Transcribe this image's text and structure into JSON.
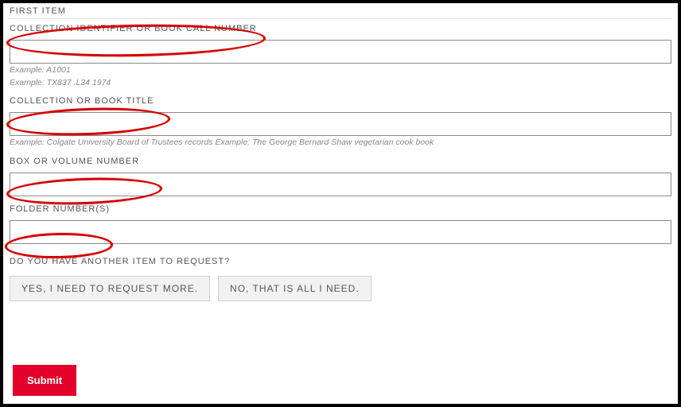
{
  "header": {
    "first_item": "FIRST ITEM"
  },
  "fields": {
    "collection_id": {
      "label": "COLLECTION IDENTIFIER OR BOOK CALL NUMBER",
      "help1": "Example: A1001",
      "help2": "Example: TX837 .L34 1974"
    },
    "collection_title": {
      "label": "COLLECTION OR BOOK TITLE",
      "help": "Example: Colgate University Board of Trustees records Example: The George Bernard Shaw vegetarian cook book"
    },
    "box_volume": {
      "label": "BOX OR VOLUME NUMBER"
    },
    "folder": {
      "label": "FOLDER NUMBER(S)"
    }
  },
  "question": {
    "label": "DO YOU HAVE ANOTHER ITEM TO REQUEST?",
    "yes": "YES, I NEED TO REQUEST MORE.",
    "no": "NO, THAT IS ALL I NEED."
  },
  "submit": {
    "label": "Submit"
  }
}
